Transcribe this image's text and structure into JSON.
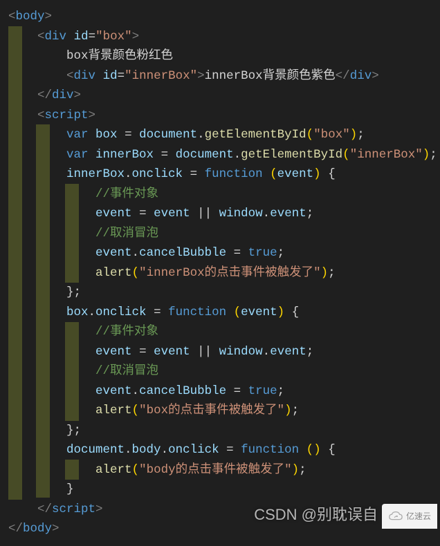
{
  "code": {
    "l1": {
      "open": "<",
      "tag": "body",
      "close": ">"
    },
    "l2": {
      "indent": "    ",
      "open": "<",
      "tag": "div",
      "sp": " ",
      "attr": "id",
      "eq": "=",
      "q1": "\"",
      "val": "box",
      "q2": "\"",
      "close": ">"
    },
    "l3": {
      "indent": "        ",
      "text": "box背景颜色粉红色"
    },
    "l4": {
      "indent": "        ",
      "open": "<",
      "tag": "div",
      "sp": " ",
      "attr": "id",
      "eq": "=",
      "q1": "\"",
      "val": "innerBox",
      "q2": "\"",
      "close": ">",
      "text": "innerBox背景颜色紫色",
      "open2": "</",
      "tag2": "div",
      "close2": ">"
    },
    "l5": {
      "indent": "    ",
      "open": "</",
      "tag": "div",
      "close": ">"
    },
    "l6": {
      "indent": "    ",
      "open": "<",
      "tag": "script",
      "close": ">"
    },
    "l7": {
      "indent": "        ",
      "kw": "var",
      "sp": " ",
      "id": "box",
      "sp2": " ",
      "eq": "=",
      "sp3": " ",
      "obj": "document",
      "dot": ".",
      "fn": "getElementById",
      "po": "(",
      "q1": "\"",
      "str": "box",
      "q2": "\"",
      "pc": ")",
      "semi": ";"
    },
    "l8": {
      "indent": "        ",
      "kw": "var",
      "sp": " ",
      "id": "innerBox",
      "sp2": " ",
      "eq": "=",
      "sp3": " ",
      "obj": "document",
      "dot": ".",
      "fn": "getElementById",
      "po": "(",
      "q1": "\"",
      "str": "innerBox",
      "q2": "\"",
      "pc": ")",
      "semi": ";"
    },
    "l9": {
      "indent": "        ",
      "id": "innerBox",
      "dot": ".",
      "prop": "onclick",
      "sp": " ",
      "eq": "=",
      "sp2": " ",
      "kw": "function",
      "sp3": " ",
      "po": "(",
      "arg": "event",
      "pc": ")",
      "sp4": " ",
      "brace": "{"
    },
    "l10": {
      "indent": "            ",
      "cmt": "//事件对象"
    },
    "l11": {
      "indent": "            ",
      "id": "event",
      "sp": " ",
      "eq": "=",
      "sp2": " ",
      "id2": "event",
      "sp3": " ",
      "op": "||",
      "sp4": " ",
      "obj": "window",
      "dot": ".",
      "prop": "event",
      "semi": ";"
    },
    "l12": {
      "indent": "            ",
      "cmt": "//取消冒泡"
    },
    "l13": {
      "indent": "            ",
      "id": "event",
      "dot": ".",
      "prop": "cancelBubble",
      "sp": " ",
      "eq": "=",
      "sp2": " ",
      "val": "true",
      "semi": ";"
    },
    "l14": {
      "indent": "            ",
      "fn": "alert",
      "po": "(",
      "q1": "\"",
      "str": "innerBox的点击事件被触发了",
      "q2": "\"",
      "pc": ")",
      "semi": ";"
    },
    "l15": {
      "indent": "        ",
      "brace": "}",
      "semi": ";"
    },
    "l16": {
      "indent": "        ",
      "id": "box",
      "dot": ".",
      "prop": "onclick",
      "sp": " ",
      "eq": "=",
      "sp2": " ",
      "kw": "function",
      "sp3": " ",
      "po": "(",
      "arg": "event",
      "pc": ")",
      "sp4": " ",
      "brace": "{"
    },
    "l17": {
      "indent": "            ",
      "cmt": "//事件对象"
    },
    "l18": {
      "indent": "            ",
      "id": "event",
      "sp": " ",
      "eq": "=",
      "sp2": " ",
      "id2": "event",
      "sp3": " ",
      "op": "||",
      "sp4": " ",
      "obj": "window",
      "dot": ".",
      "prop": "event",
      "semi": ";"
    },
    "l19": {
      "indent": "            ",
      "cmt": "//取消冒泡"
    },
    "l20": {
      "indent": "            ",
      "id": "event",
      "dot": ".",
      "prop": "cancelBubble",
      "sp": " ",
      "eq": "=",
      "sp2": " ",
      "val": "true",
      "semi": ";"
    },
    "l21": {
      "indent": "            ",
      "fn": "alert",
      "po": "(",
      "q1": "\"",
      "str": "box的点击事件被触发了",
      "q2": "\"",
      "pc": ")",
      "semi": ";"
    },
    "l22": {
      "indent": "        ",
      "brace": "}",
      "semi": ";"
    },
    "l23": {
      "indent": "        ",
      "obj": "document",
      "dot": ".",
      "prop": "body",
      "dot2": ".",
      "prop2": "onclick",
      "sp": " ",
      "eq": "=",
      "sp2": " ",
      "kw": "function",
      "sp3": " ",
      "po": "(",
      "pc": ")",
      "sp4": " ",
      "brace": "{"
    },
    "l24": {
      "indent": "            ",
      "fn": "alert",
      "po": "(",
      "q1": "\"",
      "str": "body的点击事件被触发了",
      "q2": "\"",
      "pc": ")",
      "semi": ";"
    },
    "l25": {
      "indent": "        ",
      "brace": "}"
    },
    "l26": {
      "indent": "    ",
      "open": "</",
      "tag": "script",
      "close": ">"
    },
    "l27": {
      "open": "</",
      "tag": "body",
      "close": ">"
    }
  },
  "watermark": "CSDN @别耽误自",
  "corner": "亿速云"
}
